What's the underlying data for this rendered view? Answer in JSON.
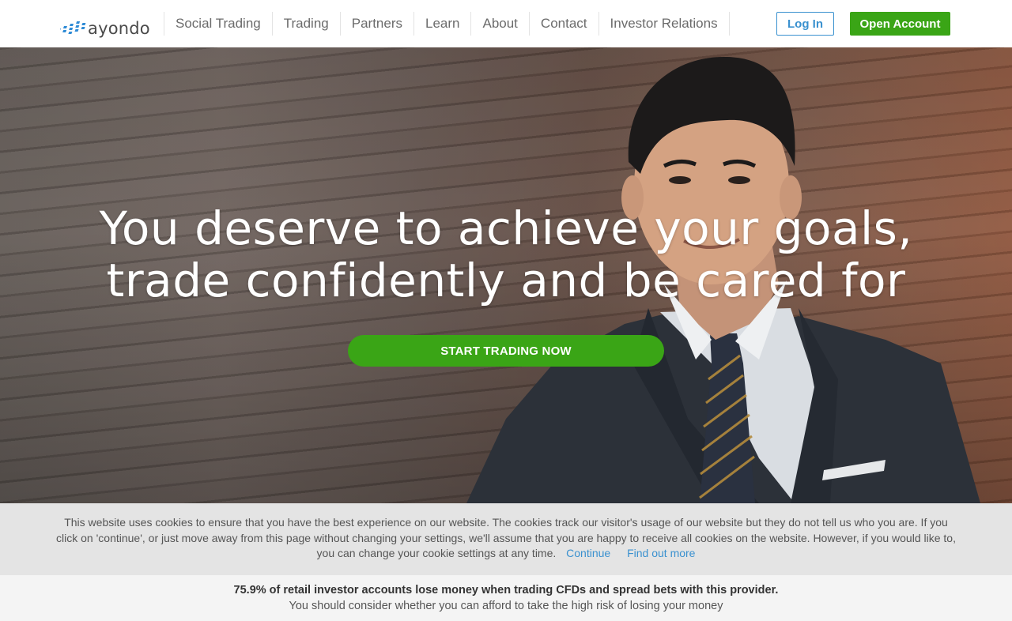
{
  "header": {
    "logo_text": "ayondo",
    "nav": [
      {
        "label": "Social Trading"
      },
      {
        "label": "Trading"
      },
      {
        "label": "Partners"
      },
      {
        "label": "Learn"
      },
      {
        "label": "About"
      },
      {
        "label": "Contact"
      },
      {
        "label": "Investor Relations"
      }
    ],
    "login_label": "Log In",
    "open_account_label": "Open Account"
  },
  "hero": {
    "title_line1": "You deserve to achieve your goals,",
    "title_line2": "trade confidently and be cared for",
    "cta_label": "START TRADING NOW"
  },
  "cookie_banner": {
    "text": "This website uses cookies to ensure that you have the best experience on our website. The cookies track our visitor's usage of our website but they do not tell us who you are. If you click on 'continue', or just move away from this page without changing your settings, we'll assume that you are happy to receive all cookies on the website. However, if you would like to, you can change your cookie settings at any time.",
    "continue_label": "Continue",
    "find_out_more_label": "Find out more"
  },
  "risk_warning": {
    "headline": "75.9% of retail investor accounts lose money when trading CFDs and spread bets with this provider.",
    "subline": "You should consider whether you can afford to take the high risk of losing your money"
  },
  "colors": {
    "brand_green": "#3aa516",
    "link_blue": "#3a91cf",
    "logo_blue": "#2e8bd6"
  }
}
